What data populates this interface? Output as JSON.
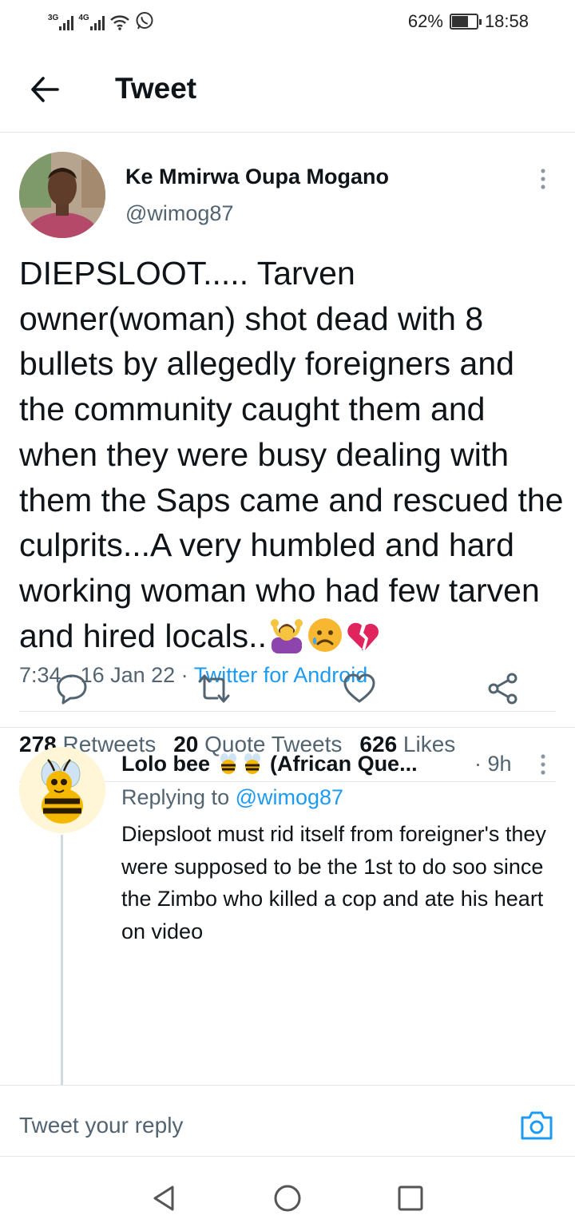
{
  "status_bar": {
    "network_1": "3G",
    "network_2": "4G",
    "battery": "62%",
    "time": "18:58"
  },
  "header": {
    "title": "Tweet"
  },
  "tweet": {
    "author_name": "Ke Mmirwa Oupa Mogano",
    "author_handle": "@wimog87",
    "text": "DIEPSLOOT..... Tarven owner(woman) shot dead with 8 bullets by allegedly foreigners and the community caught them and when they were busy dealing with them the Saps came and rescued the culprits...A very humbled and hard working woman who had few tarven and hired locals..",
    "emojis": [
      "woman-gesturing-ok-icon",
      "sad-face-icon",
      "broken-heart-icon"
    ],
    "time": "7:34",
    "date": "16 Jan 22",
    "source": "Twitter for Android",
    "separator": " · ",
    "stats": {
      "retweets_count": "278",
      "retweets_label": "Retweets",
      "quotes_count": "20",
      "quotes_label": "Quote Tweets",
      "likes_count": "626",
      "likes_label": "Likes"
    }
  },
  "reply": {
    "author_name": "Lolo bee",
    "author_suffix": "(African Que...",
    "time": "· 9h",
    "replying_prefix": "Replying to",
    "replying_to": "@wimog87",
    "text": "Diepsloot must rid itself from foreigner's they were supposed to be the 1st to do soo since the Zimbo who killed a cop and ate his heart on video"
  },
  "composer": {
    "placeholder": "Tweet your reply"
  },
  "colors": {
    "link": "#1d9bf0",
    "secondary_text": "#536471",
    "primary_text": "#0f1419",
    "divider": "#e6e9eb"
  }
}
